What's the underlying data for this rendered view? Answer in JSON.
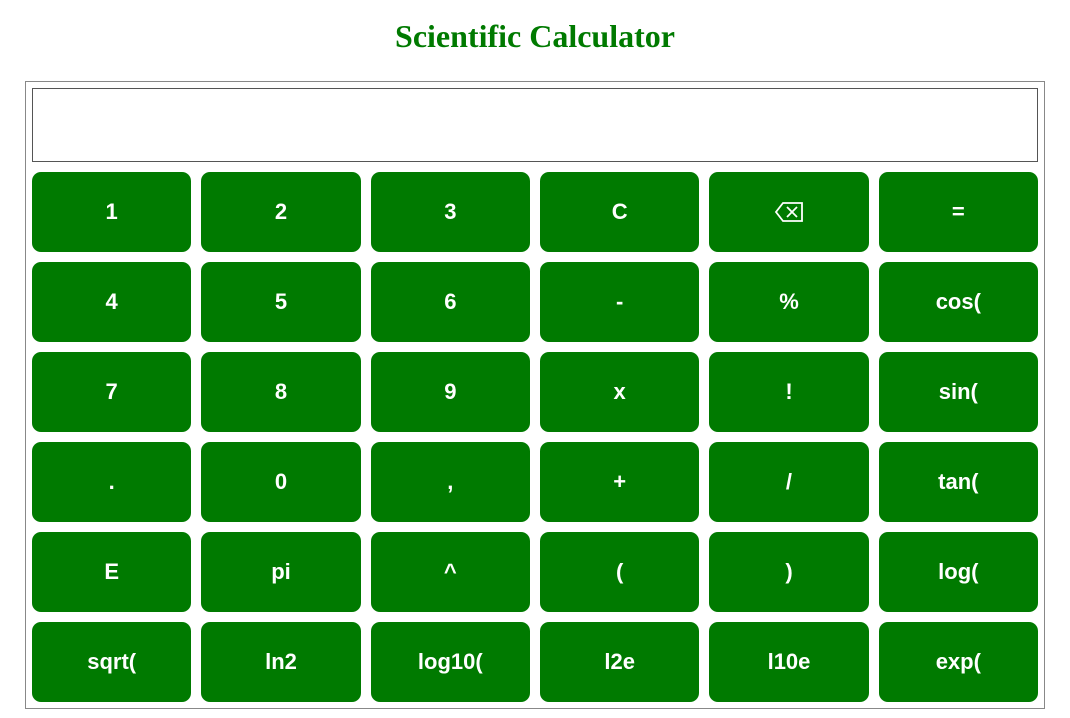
{
  "title": "Scientific Calculator",
  "display_value": "",
  "display_placeholder": "",
  "buttons": {
    "r0c0": "1",
    "r0c1": "2",
    "r0c2": "3",
    "r0c3": "C",
    "r0c5": "=",
    "r1c0": "4",
    "r1c1": "5",
    "r1c2": "6",
    "r1c3": "-",
    "r1c4": "%",
    "r1c5": "cos(",
    "r2c0": "7",
    "r2c1": "8",
    "r2c2": "9",
    "r2c3": "x",
    "r2c4": "!",
    "r2c5": "sin(",
    "r3c0": ".",
    "r3c1": "0",
    "r3c2": ",",
    "r3c3": "+",
    "r3c4": "/",
    "r3c5": "tan(",
    "r4c0": "E",
    "r4c1": "pi",
    "r4c2": "^",
    "r4c3": "(",
    "r4c4": ")",
    "r4c5": "log(",
    "r5c0": "sqrt(",
    "r5c1": "ln2",
    "r5c2": "log10(",
    "r5c3": "l2e",
    "r5c4": "l10e",
    "r5c5": "exp("
  }
}
